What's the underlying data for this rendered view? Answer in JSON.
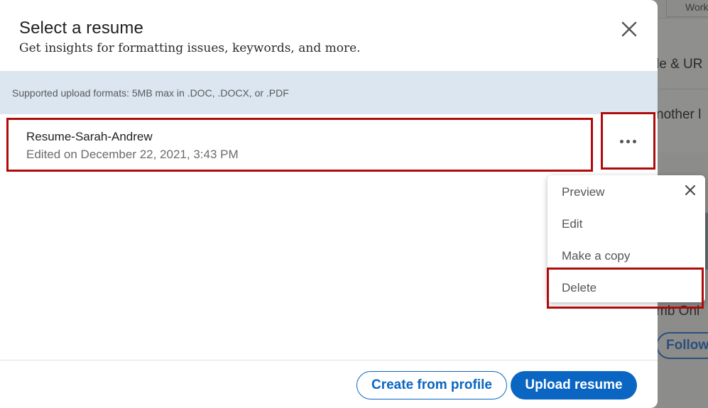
{
  "background": {
    "tab_label": "Work",
    "line1": "le & UR",
    "line2": "nother l",
    "line3": "mb Onl",
    "follow_label": "Follow"
  },
  "modal": {
    "title": "Select a resume",
    "subtitle": "Get insights for formatting issues, keywords, and more.",
    "info": "Supported upload formats: 5MB max in .DOC, .DOCX, or .PDF",
    "resume": {
      "name": "Resume-Sarah-Andrew",
      "edited": "Edited on December 22, 2021, 3:43 PM"
    },
    "buttons": {
      "create": "Create from profile",
      "upload": "Upload resume"
    }
  },
  "menu": {
    "items": [
      "Preview",
      "Edit",
      "Make a copy",
      "Delete"
    ]
  },
  "colors": {
    "accent": "#0a66c2",
    "info_bg": "#dce6f0",
    "highlight": "#b00b0b"
  }
}
